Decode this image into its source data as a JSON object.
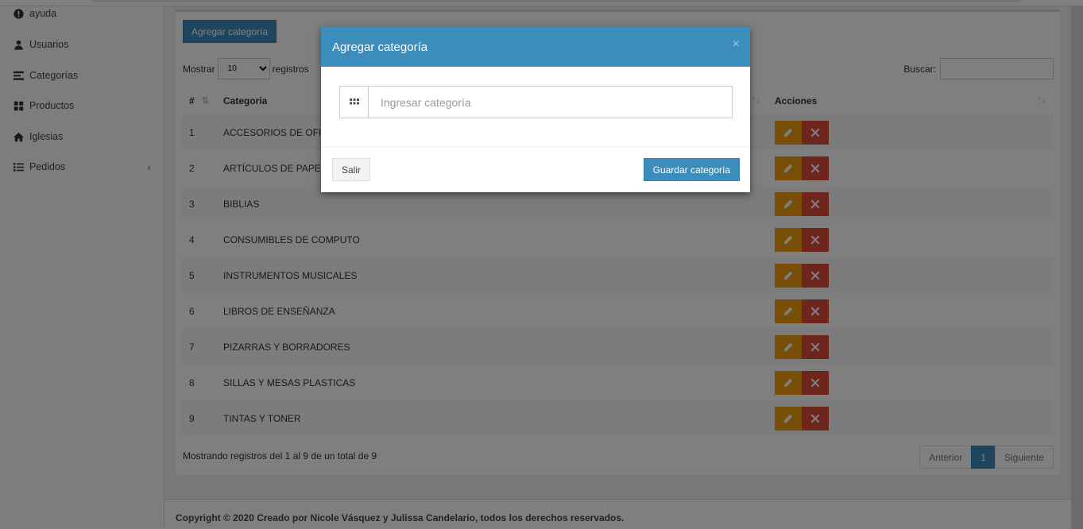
{
  "sidebar": {
    "items": [
      {
        "label": "ayuda",
        "icon": "exclamation-circle-icon"
      },
      {
        "label": "Usuarios",
        "icon": "user-icon"
      },
      {
        "label": "Categorías",
        "icon": "list-icon"
      },
      {
        "label": "Productos",
        "icon": "products-icon"
      },
      {
        "label": "Iglesias",
        "icon": "home-icon"
      },
      {
        "label": "Pedidos",
        "icon": "list-ul-icon",
        "chevron": "‹"
      }
    ]
  },
  "main": {
    "add_button": "Agregar categoría",
    "length": {
      "prefix": "Mostrar",
      "value": "10",
      "suffix": "registros"
    },
    "search_label": "Buscar:",
    "table": {
      "headers": [
        "#",
        "Categoria",
        "Acciones"
      ],
      "rows": [
        {
          "num": "1",
          "name": "ACCESORIOS DE OFICINA"
        },
        {
          "num": "2",
          "name": "ARTÍCULOS DE PAPELERÍA"
        },
        {
          "num": "3",
          "name": "BIBLIAS"
        },
        {
          "num": "4",
          "name": "CONSUMIBLES DE COMPUTO"
        },
        {
          "num": "5",
          "name": "INSTRUMENTOS MUSICALES"
        },
        {
          "num": "6",
          "name": "LIBROS DE ENSEÑANZA"
        },
        {
          "num": "7",
          "name": "PIZARRAS Y BORRADORES"
        },
        {
          "num": "8",
          "name": "SILLAS Y MESAS PLASTICAS"
        },
        {
          "num": "9",
          "name": "TINTAS Y TONER"
        }
      ]
    },
    "info": "Mostrando registros del 1 al 9 de un total de 9",
    "pagination": {
      "prev": "Anterior",
      "page": "1",
      "next": "Siguiente"
    }
  },
  "footer": "Copyright © 2020 Creado por Nicole Vásquez y Julissa Candelario, todos los derechos reservados.",
  "modal": {
    "title": "Agregar categoría",
    "close": "×",
    "input_placeholder": "Ingresar categoría",
    "cancel": "Salir",
    "save": "Guardar categoría"
  },
  "colors": {
    "primary": "#3c8dbc",
    "edit": "#f39c12",
    "delete": "#dd4b39"
  }
}
